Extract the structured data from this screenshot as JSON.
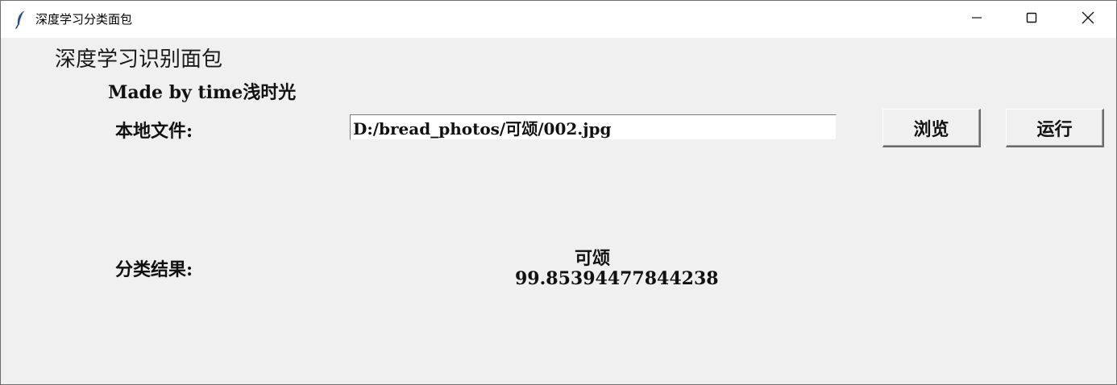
{
  "window": {
    "title": "深度学习分类面包",
    "icon": "feather-icon",
    "controls": {
      "minimize": "minimize-icon",
      "maximize": "maximize-icon",
      "close": "close-icon"
    }
  },
  "header": {
    "title": "深度学习识别面包",
    "subtitle": "Made by time浅时光"
  },
  "file": {
    "label": "本地文件:",
    "path": "D:/bread_photos/可颂/002.jpg",
    "browse_label": "浏览",
    "run_label": "运行"
  },
  "result": {
    "label": "分类结果:",
    "class_name": "可颂",
    "score": "99.85394477844238"
  }
}
